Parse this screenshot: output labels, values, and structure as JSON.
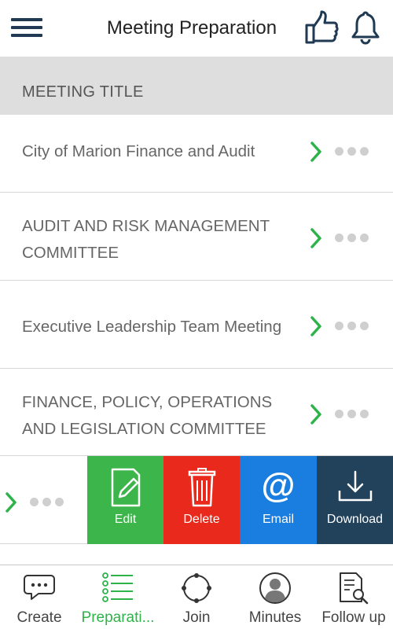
{
  "header": {
    "title": "Meeting Preparation",
    "menu_icon": "hamburger-menu-icon",
    "like_icon": "thumbs-up-icon",
    "notification_icon": "bell-icon"
  },
  "section": {
    "title": "MEETING TITLE"
  },
  "meetings": [
    {
      "line1": "City of Marion Finance and Audit",
      "line2": ""
    },
    {
      "line1": "AUDIT AND RISK MANAGEMENT",
      "line2": "COMMITTEE"
    },
    {
      "line1": "Executive Leadership Team Meeting",
      "line2": ""
    },
    {
      "line1": "FINANCE, POLICY, OPERATIONS",
      "line2": "AND LEGISLATION COMMITTEE"
    }
  ],
  "swipe_actions": {
    "edit": "Edit",
    "delete": "Delete",
    "email": "Email",
    "download": "Download"
  },
  "tabs": [
    {
      "label": "Create",
      "icon": "chat-bubble-icon",
      "active": false
    },
    {
      "label": "Preparati...",
      "icon": "checklist-icon",
      "active": true
    },
    {
      "label": "Join",
      "icon": "join-circle-icon",
      "active": false
    },
    {
      "label": "Minutes",
      "icon": "user-avatar-icon",
      "active": false
    },
    {
      "label": "Follow up",
      "icon": "document-search-icon",
      "active": false
    }
  ],
  "colors": {
    "accent_green": "#2db34a",
    "edit_green": "#3cb54a",
    "delete_red": "#e8291c",
    "email_blue": "#1a7de0",
    "download_navy": "#22415b",
    "header_navy": "#1f3a52"
  }
}
